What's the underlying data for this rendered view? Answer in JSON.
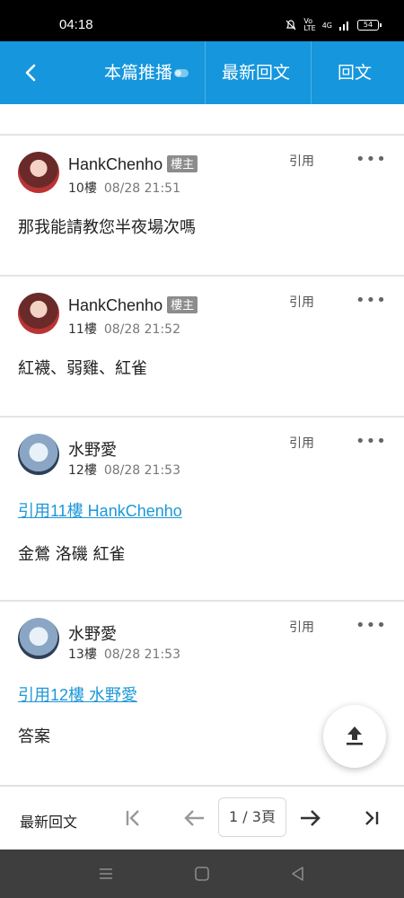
{
  "status": {
    "time": "04:18",
    "battery": "54",
    "network": "4G"
  },
  "topbar": {
    "tab_this": "本篇推播",
    "tab_latest": "最新回文",
    "tab_reply": "回文"
  },
  "posts": [
    {
      "username": "HankChenho",
      "badge": "樓主",
      "floor": "10樓",
      "time": "08/28 21:51",
      "quote_label": "引用",
      "more": "•••",
      "quote_ref": "",
      "text": "那我能請教您半夜場次嗎"
    },
    {
      "username": "HankChenho",
      "badge": "樓主",
      "floor": "11樓",
      "time": "08/28 21:52",
      "quote_label": "引用",
      "more": "•••",
      "quote_ref": "",
      "text": "紅襪、弱雞、紅雀"
    },
    {
      "username": "水野愛",
      "badge": "",
      "floor": "12樓",
      "time": "08/28 21:53",
      "quote_label": "引用",
      "more": "•••",
      "quote_ref": "引用11樓 HankChenho",
      "text": "金鶯 洛磯 紅雀"
    },
    {
      "username": "水野愛",
      "badge": "",
      "floor": "13樓",
      "time": "08/28 21:53",
      "quote_label": "引用",
      "more": "•••",
      "quote_ref": "引用12樓 水野愛",
      "text": "答案"
    }
  ],
  "bottombar": {
    "label": "最新回文",
    "page_indicator": "1 / 3頁"
  },
  "colors": {
    "brand": "#1596dd",
    "link": "#1e97d8"
  }
}
